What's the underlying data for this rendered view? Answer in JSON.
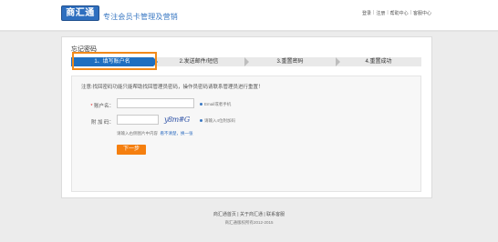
{
  "header": {
    "logo_text": "商汇通",
    "slogan": "专注会员卡管理及营销",
    "nav": [
      "登录",
      "注册",
      "帮助中心",
      "客服中心"
    ],
    "nav_sep": "|"
  },
  "page": {
    "title": "忘记密码",
    "steps": [
      "1、填写账户名",
      "2.发送邮件/短信",
      "3.重置密码",
      "4.重置成功"
    ]
  },
  "form": {
    "intro": "注意:找回密码功能只能帮助找回管理员密码，操作员密码请联系管理员进行重置！",
    "account_label": "账户名：",
    "account_hint": "Email或者手机",
    "code_label": "附 加 码：",
    "captcha_text": "y8m#G",
    "code_hint": "请输入4位附加码",
    "captcha_tip": "请输入右侧图片中内容",
    "captcha_refresh": "看不清楚，换一张",
    "next_button": "下一步",
    "required_mark": "*"
  },
  "footer": {
    "links": "商汇通首页 | 关于商汇通 | 联系客服",
    "copyright": "商汇通版权所有2012-2015"
  },
  "colors": {
    "brand_blue": "#2e6fbf",
    "active_step": "#1f6fc0",
    "highlight_orange": "#f28a1a",
    "button_orange": "#f57f0f"
  }
}
